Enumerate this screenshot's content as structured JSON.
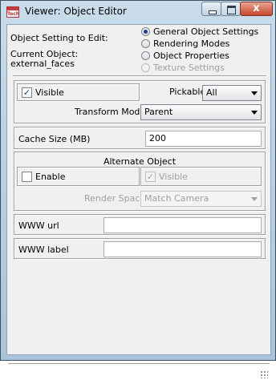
{
  "window": {
    "title": "Viewer: Object Editor",
    "app_icon_text": "Tech",
    "close_glyph": "x"
  },
  "setting": {
    "label": "Object Setting to Edit:",
    "current_label": "Current Object:",
    "current_value": "external_faces",
    "options": [
      {
        "label": "General Object Settings",
        "selected": true,
        "enabled": true
      },
      {
        "label": "Rendering Modes",
        "selected": false,
        "enabled": true
      },
      {
        "label": "Object Properties",
        "selected": false,
        "enabled": true
      },
      {
        "label": "Texture Settings",
        "selected": false,
        "enabled": false
      }
    ]
  },
  "visibility": {
    "visible_label": "Visible",
    "visible_checked": true,
    "pickable_label": "Pickable",
    "pickable_value": "All",
    "transform_label": "Transform Mode",
    "transform_value": "Parent"
  },
  "cache": {
    "label": "Cache Size (MB)",
    "value": "200"
  },
  "alternate": {
    "title": "Alternate Object",
    "enable_label": "Enable",
    "enable_checked": false,
    "visible_label": "Visible",
    "visible_checked": true,
    "render_space_label": "Render Space",
    "render_space_value": "Match Camera"
  },
  "www": {
    "url_label": "WWW url",
    "url_value": "",
    "label_label": "WWW label",
    "label_value": ""
  },
  "icons": {
    "check": "✓"
  }
}
